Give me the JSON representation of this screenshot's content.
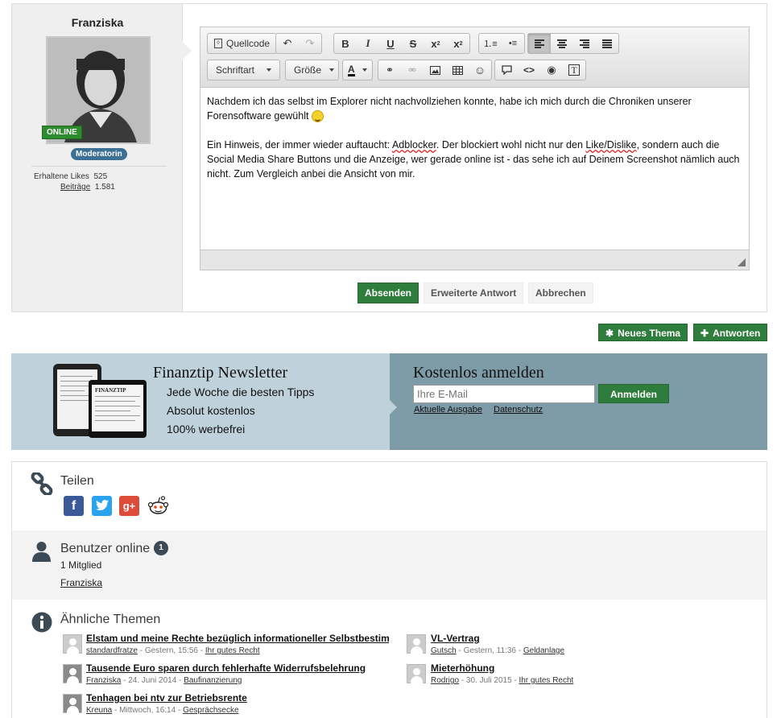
{
  "post": {
    "username": "Franziska",
    "online_badge": "ONLINE",
    "role": "Moderatorin",
    "likes_label": "Erhaltene Likes",
    "likes_value": "525",
    "posts_label": "Beiträge",
    "posts_value": "1.581"
  },
  "editor": {
    "source_label": "Quellcode",
    "font_label": "Schriftart",
    "size_label": "Größe",
    "text_color_label": "A",
    "paragraph1": "Nachdem ich das selbst im Explorer nicht nachvollziehen konnte, habe ich mich durch die Chroniken unserer Forensoftware gewühlt",
    "p2_a": "Ein Hinweis, der immer wieder auftaucht: ",
    "p2_adblocker": "Adblocker",
    "p2_b": ". Der blockiert wohl nicht nur den ",
    "p2_like": "Like/Dislike",
    "p2_c": ", sondern auch die Social Media Share Buttons und die Anzeige, wer gerade online ist - das sehe ich auf Deinem Screenshot nämlich auch nicht. Zum Vergleich anbei die Ansicht von mir."
  },
  "actions": {
    "submit": "Absenden",
    "advanced": "Erweiterte Antwort",
    "cancel": "Abbrechen",
    "new_thread": "Neues Thema",
    "reply": "Antworten"
  },
  "newsletter": {
    "title": "Finanztip Newsletter",
    "items": [
      "Jede Woche die besten Tipps",
      "Absolut kostenlos",
      "100% werbefrei"
    ],
    "signup_title": "Kostenlos anmelden",
    "email_placeholder": "Ihre E-Mail",
    "signup_button": "Anmelden",
    "link_current": "Aktuelle Ausgabe",
    "link_privacy": "Datenschutz",
    "device_brand": "FINANZTIP"
  },
  "share": {
    "title": "Teilen",
    "icons": [
      "facebook-icon",
      "twitter-icon",
      "google-plus-icon",
      "reddit-icon"
    ],
    "colors": {
      "facebook": "#3b5998",
      "twitter": "#2aa3ef",
      "google_plus": "#dd4b39"
    }
  },
  "online": {
    "title": "Benutzer online",
    "count": "1",
    "members": "1 Mitglied",
    "user": "Franziska"
  },
  "similar": {
    "title": "Ähnliche Themen",
    "threads": [
      {
        "title": "Elstam und meine Rechte bezüglich informationeller Selbstbestimmung",
        "author": "standardfratze",
        "date": " - Gestern, 15:56 - ",
        "forum": "Ihr gutes Recht"
      },
      {
        "title": "VL-Vertrag",
        "author": "Gutsch",
        "date": " - Gestern, 11:36 - ",
        "forum": "Geldanlage"
      },
      {
        "title": "Tausende Euro sparen durch fehlerhafte Widerrufsbelehrung",
        "author": "Franziska",
        "date": " - 24. Juni 2014 - ",
        "forum": "Baufinanzierung"
      },
      {
        "title": "Mieterhöhung",
        "author": "Rodrigo",
        "date": " - 30. Juli 2015 - ",
        "forum": "Ihr gutes Recht"
      },
      {
        "title": "Tenhagen bei ntv zur Betriebsrente",
        "author": "Kreuna",
        "date": " - Mittwoch, 16:14 - ",
        "forum": "Gesprächsecke"
      }
    ]
  },
  "colors": {
    "accent_green": "#2f7d3c",
    "newsletter_light": "#bfd1da",
    "newsletter_dark": "#7e9ba8"
  }
}
